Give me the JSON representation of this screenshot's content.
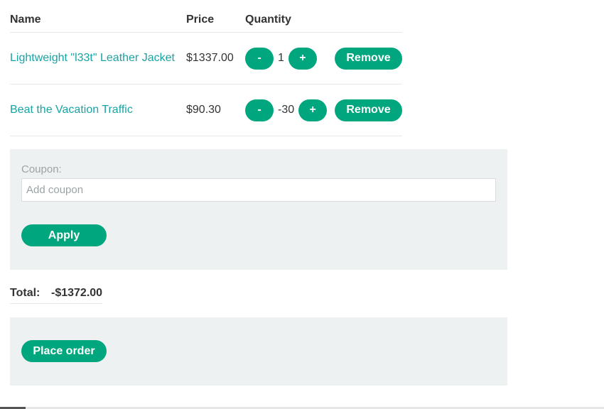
{
  "table": {
    "headers": {
      "name": "Name",
      "price": "Price",
      "quantity": "Quantity"
    },
    "rows": [
      {
        "name": "Lightweight \"l33t\" Leather Jacket",
        "price": "$1337.00",
        "minus": "-",
        "quantity": "1",
        "plus": "+",
        "remove": "Remove"
      },
      {
        "name": "Beat the Vacation Traffic",
        "price": "$90.30",
        "minus": "-",
        "quantity": "-30",
        "plus": "+",
        "remove": "Remove"
      }
    ]
  },
  "coupon": {
    "label": "Coupon:",
    "placeholder": "Add coupon",
    "apply_label": "Apply"
  },
  "total": {
    "label": "Total:",
    "value": "-$1372.00"
  },
  "order": {
    "place_order_label": "Place order"
  },
  "colors": {
    "accent": "#00a67e",
    "link": "#1aa3a3",
    "panel": "#eef1f2"
  }
}
